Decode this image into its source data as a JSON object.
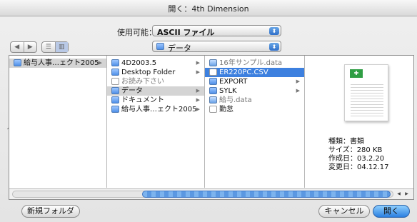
{
  "title": "開く：4th Dimension",
  "enable": {
    "label": "使用可能：",
    "value": "ASCII ファイル"
  },
  "nav": {
    "back": "◀",
    "forward": "▶",
    "list_view": "☰",
    "column_view": "▥"
  },
  "location": {
    "value": "データ"
  },
  "columns": [
    {
      "items": [
        {
          "name": "給与人事…ェクト2005",
          "icon": "folder-icon",
          "state": "gray",
          "arrow": "▶"
        }
      ]
    },
    {
      "items": [
        {
          "name": "4D2003.5",
          "icon": "folder-icon",
          "arrow": "▶"
        },
        {
          "name": "Desktop Folder",
          "icon": "folder-icon",
          "arrow": "▶"
        },
        {
          "name": "お読み下さい",
          "icon": "document-icon",
          "state": "dim",
          "arrow": ""
        },
        {
          "name": "データ",
          "icon": "folder-icon",
          "state": "gray",
          "arrow": "▶"
        },
        {
          "name": "ドキュメント",
          "icon": "folder-icon",
          "arrow": "▶"
        },
        {
          "name": "給与人事…ェクト2005",
          "icon": "folder-icon",
          "arrow": "▶"
        }
      ]
    },
    {
      "items": [
        {
          "name": "16年サンプル.data",
          "icon": "database-icon",
          "state": "dim",
          "arrow": ""
        },
        {
          "name": "ER220PC.CSV",
          "icon": "document-icon",
          "state": "blue",
          "arrow": ""
        },
        {
          "name": "EXPORT",
          "icon": "folder-icon",
          "arrow": "▶"
        },
        {
          "name": "SYLK",
          "icon": "folder-icon",
          "arrow": "▶"
        },
        {
          "name": "給与.data",
          "icon": "database-icon",
          "state": "dim",
          "arrow": ""
        },
        {
          "name": "勤怠",
          "icon": "document-icon",
          "arrow": ""
        }
      ]
    }
  ],
  "preview": {
    "icon": "spreadsheet-document-icon",
    "kind": "種類：書類",
    "size": "サイズ：280 KB",
    "created": "作成日：03.2.20",
    "modified": "変更日：04.12.17"
  },
  "buttons": {
    "new_folder": "新規フォルダ",
    "cancel": "キャンセル",
    "open": "開く"
  },
  "colors": {
    "selection": "#3d80df",
    "default_button": "#2a7fe0"
  }
}
